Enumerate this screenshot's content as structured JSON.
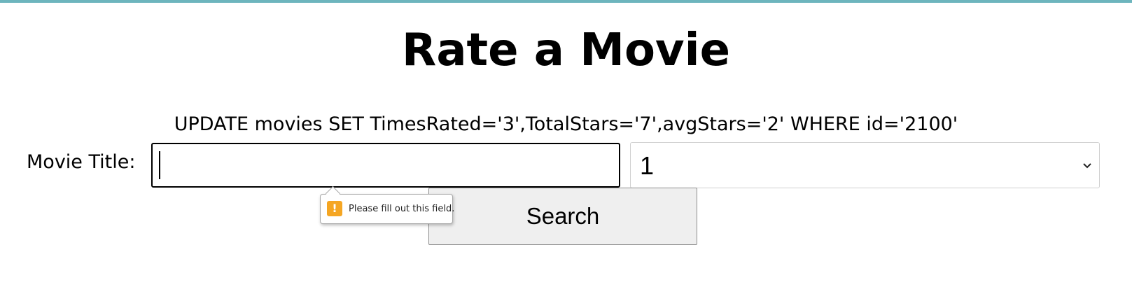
{
  "page": {
    "title": "Rate a Movie",
    "sql_message": "UPDATE movies SET TimesRated='3',TotalStars='7',avgStars='2' WHERE id='2100'"
  },
  "form": {
    "title_label": "Movie Title:",
    "title_value": "",
    "rating_selected": "1",
    "search_label": "Search"
  },
  "validation": {
    "message": "Please fill out this field.",
    "icon": "warning-icon",
    "icon_glyph": "!"
  },
  "colors": {
    "accent_bar": "#6db5bd",
    "warning": "#f5a623"
  }
}
